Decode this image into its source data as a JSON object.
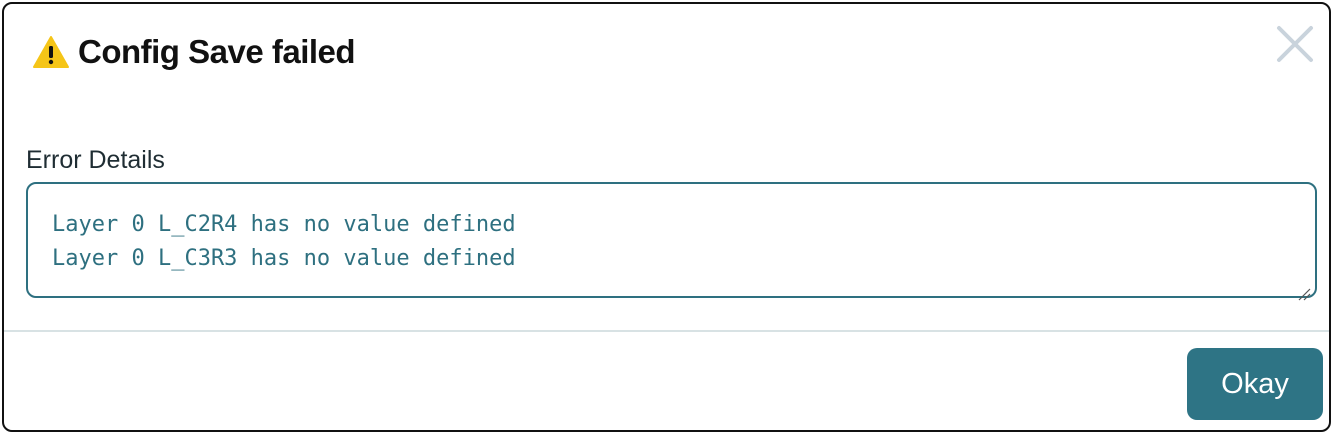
{
  "dialog": {
    "title": "Config Save failed",
    "title_icon": "warning-triangle-icon",
    "close_icon": "close-icon",
    "field_label": "Error Details",
    "error_lines": [
      "Layer 0 L_C2R4 has no value defined",
      "Layer 0 L_C3R3 has no value defined"
    ],
    "okay_label": "Okay"
  },
  "colors": {
    "accent": "#2e7485",
    "warning": "#f5c518",
    "close_icon": "#c9d3dc",
    "divider": "#d8e2e4"
  }
}
